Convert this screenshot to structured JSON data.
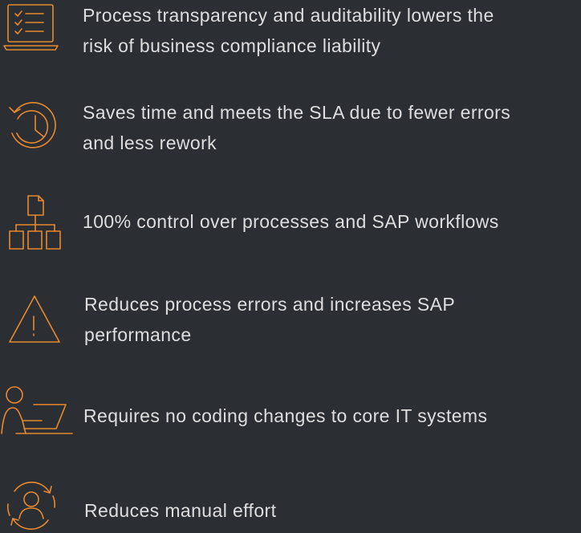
{
  "accent_color": "#e8892e",
  "background_color": "#2b2e33",
  "benefits": [
    {
      "icon": "checklist-laptop-icon",
      "lines": [
        "Process transparency and auditability lowers the",
        "risk of business compliance liability"
      ]
    },
    {
      "icon": "clock-history-icon",
      "lines": [
        "Saves time and meets the SLA due to fewer errors",
        "and less rework"
      ]
    },
    {
      "icon": "hierarchy-icon",
      "lines": [
        "100% control over processes and SAP workflows"
      ]
    },
    {
      "icon": "warning-triangle-icon",
      "lines": [
        "Reduces process errors and increases SAP",
        "performance"
      ]
    },
    {
      "icon": "person-laptop-icon",
      "lines": [
        "Requires no coding changes to core IT systems"
      ]
    },
    {
      "icon": "person-cycle-icon",
      "lines": [
        "Reduces manual effort"
      ]
    }
  ]
}
